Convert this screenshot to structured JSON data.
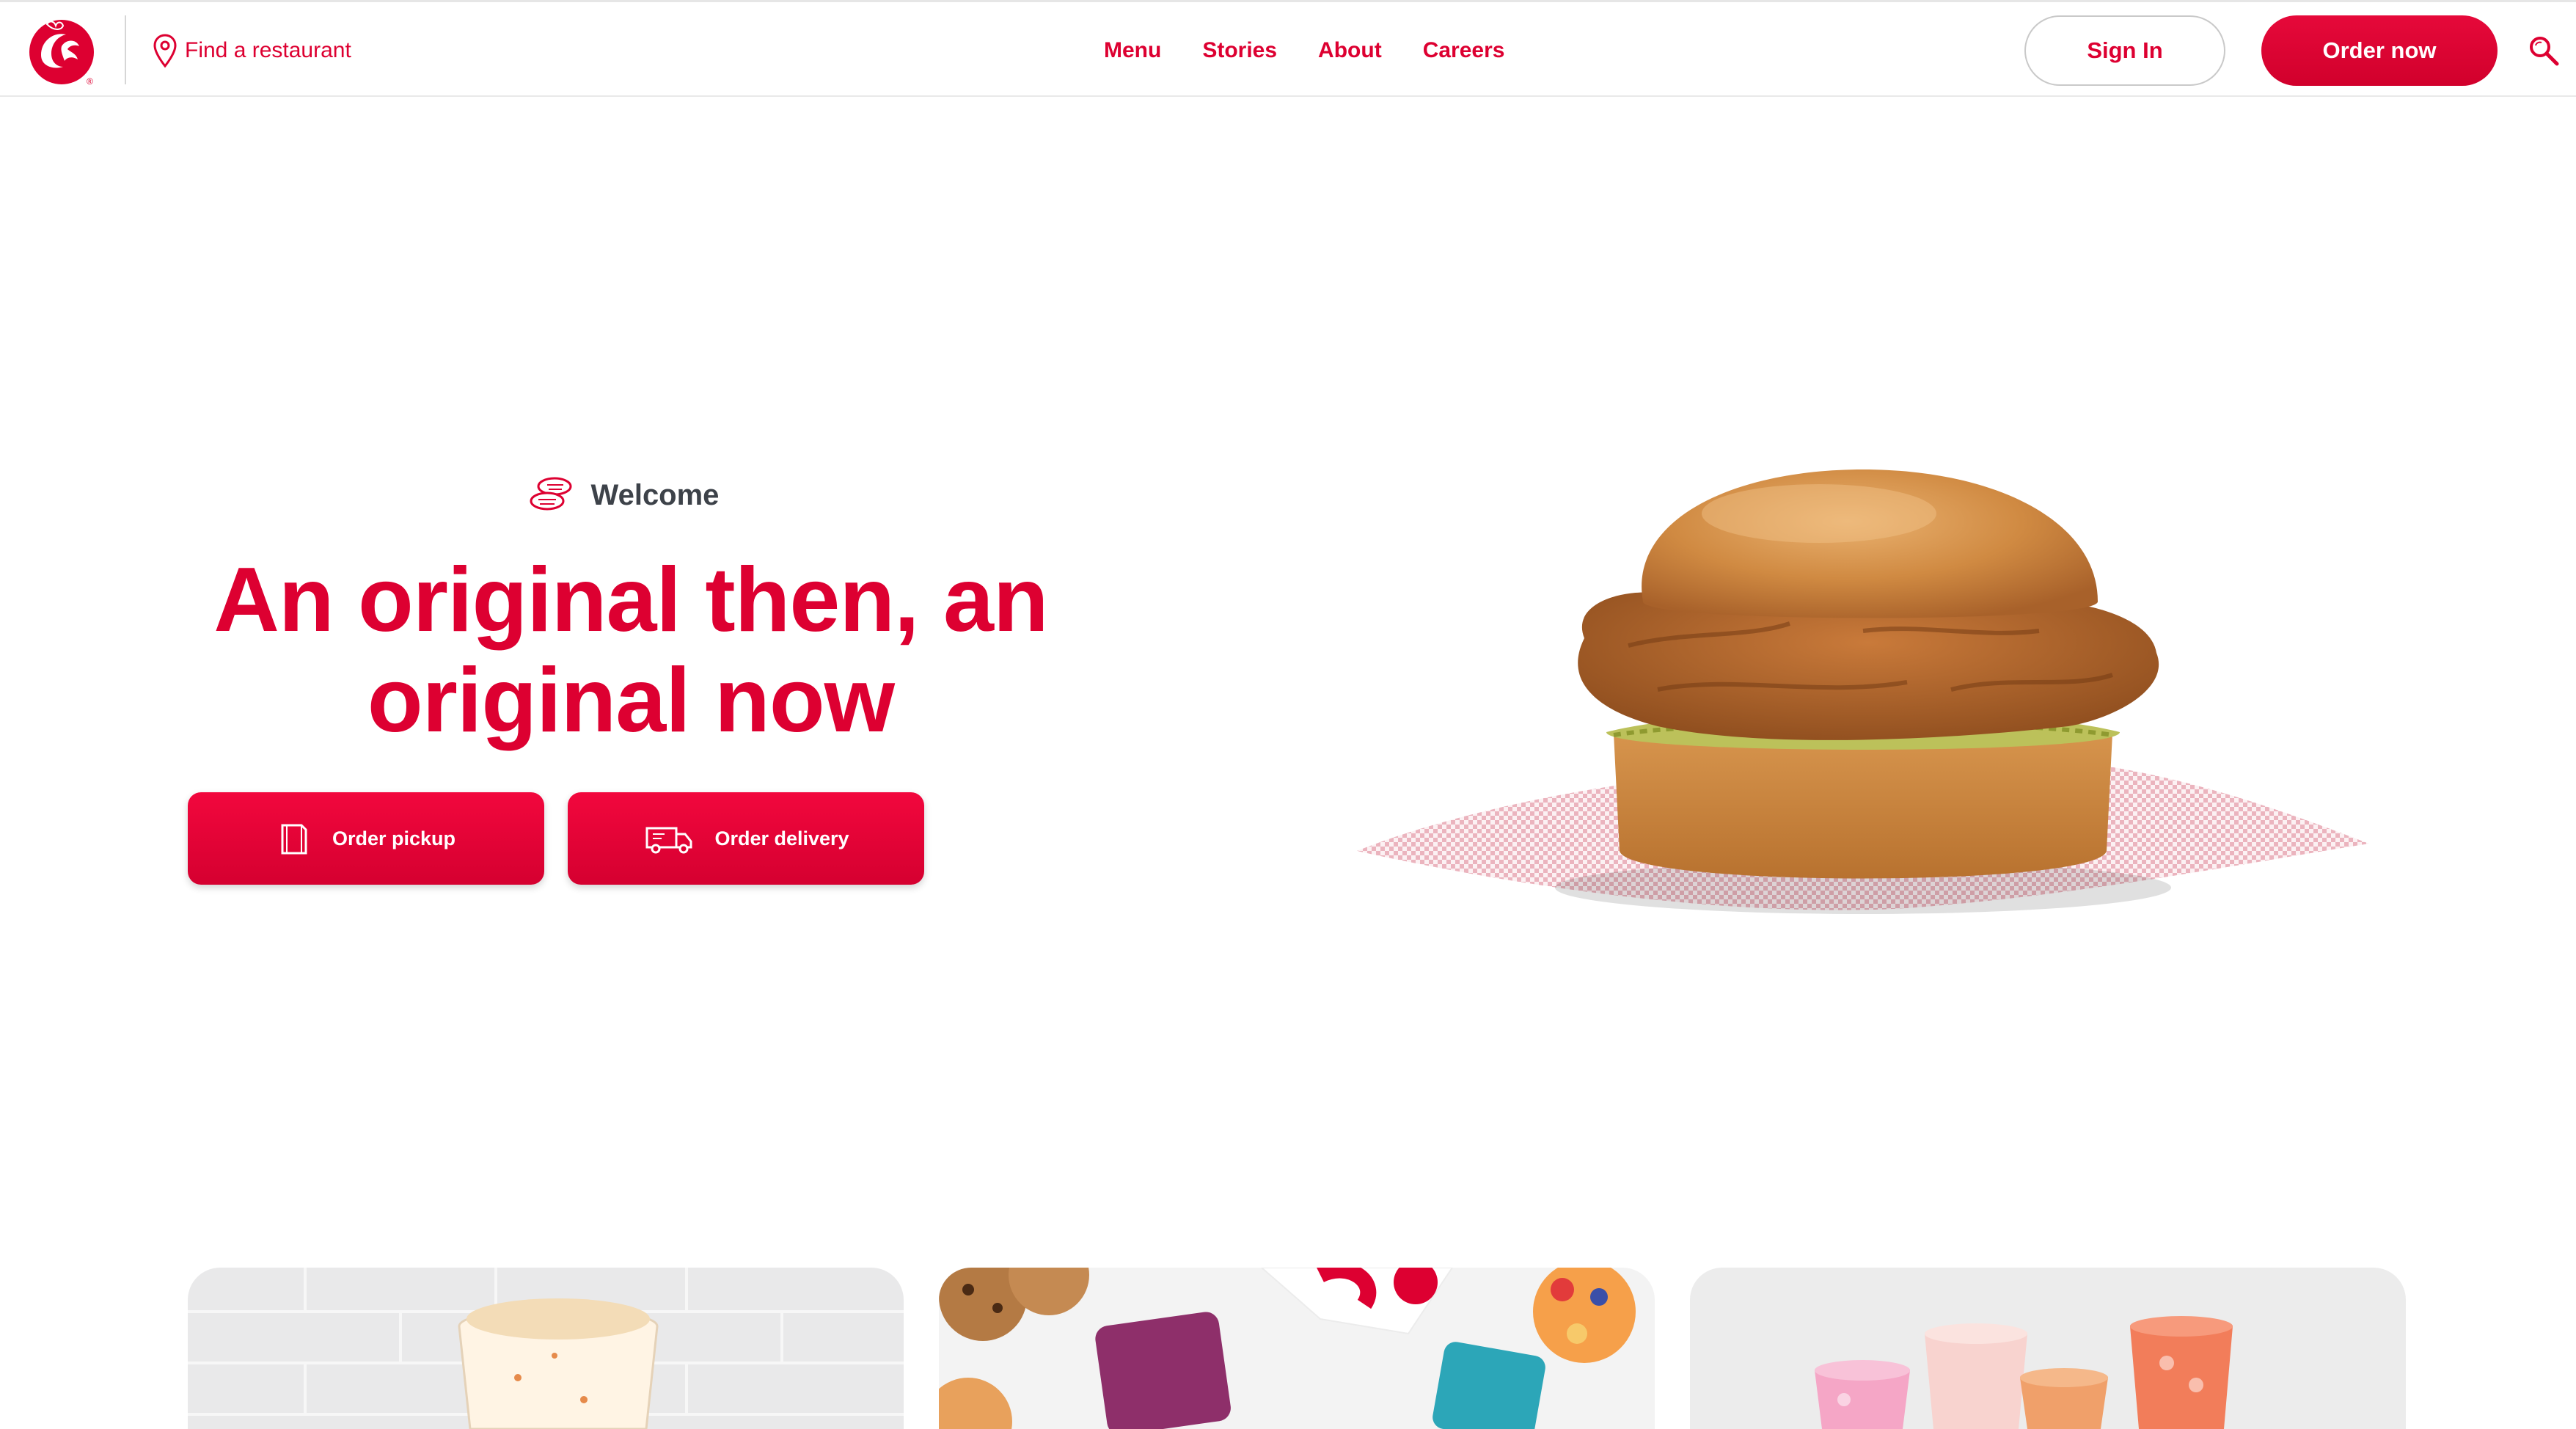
{
  "header": {
    "find_restaurant": "Find a restaurant",
    "nav": [
      "Menu",
      "Stories",
      "About",
      "Careers"
    ],
    "sign_in": "Sign In",
    "order_now": "Order now"
  },
  "hero": {
    "eyebrow": "Welcome",
    "headline_line1": "An original then, an",
    "headline_line2": "original now",
    "order_pickup": "Order pickup",
    "order_delivery": "Order delivery"
  },
  "colors": {
    "brand_red": "#dd0031",
    "text_dark": "#3d4249"
  },
  "icons": [
    "logo",
    "location-pin-icon",
    "search-icon",
    "nuggets-icon",
    "pickup-bag-icon",
    "delivery-van-icon"
  ]
}
